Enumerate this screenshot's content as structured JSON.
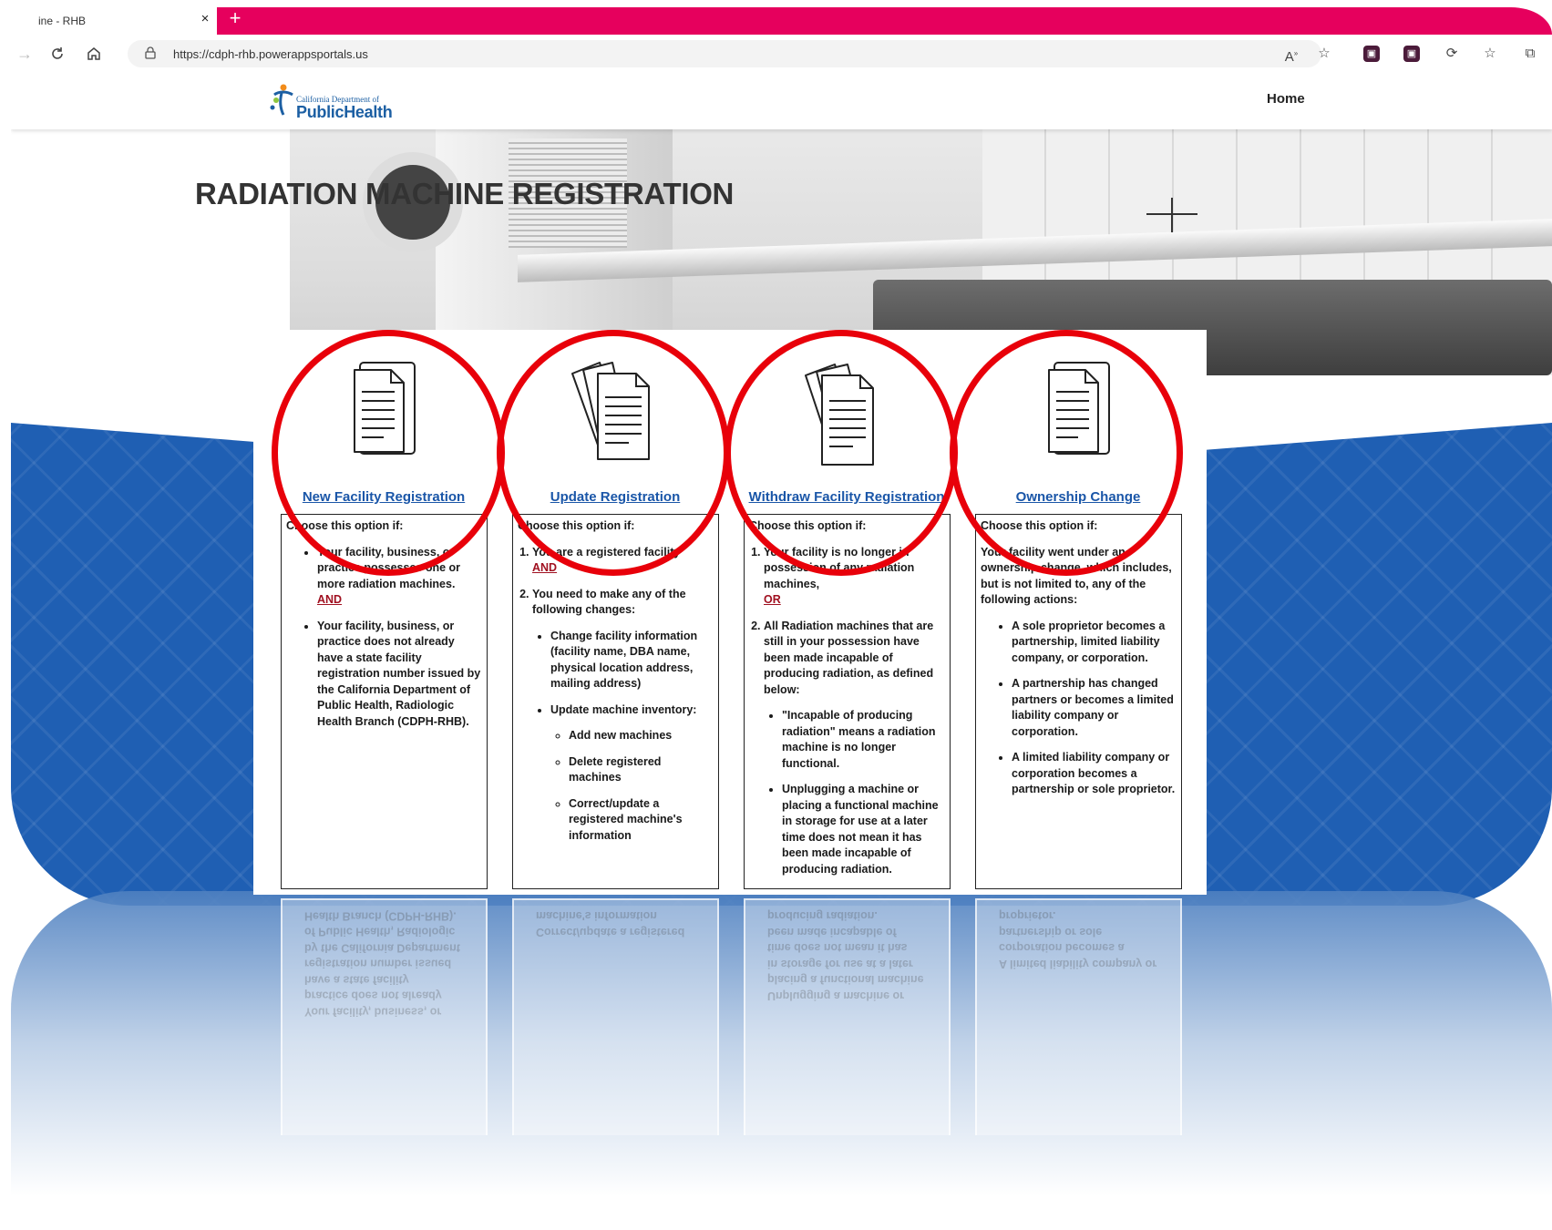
{
  "browser": {
    "tab_title": "ine - RHB",
    "tab_close": "×",
    "new_tab": "+",
    "url": "https://cdph-rhb.powerappsportals.us",
    "nav": {
      "back": "→",
      "refresh": "C",
      "home": "⌂"
    },
    "toolbar_icons": [
      "read-aloud-icon",
      "favorite-add-icon",
      "extension-icon",
      "extension-icon",
      "extensions-icon",
      "favorites-icon",
      "collections-icon"
    ]
  },
  "site": {
    "logo_small": "California Department of",
    "logo_big": "PublicHealth",
    "nav_home": "Home",
    "page_title": "RADIATION MACHINE REGISTRATION"
  },
  "cards": [
    {
      "link": "New Facility Registration",
      "lead": "Choose this option if:",
      "items": [
        "Your facility, business, or practice possesses one or more radiation machines.",
        "AND",
        "Your facility, business, or practice does not already have a state facility registration number issued by the California Department of Public Health, Radiologic Health Branch (CDPH-RHB)."
      ]
    },
    {
      "link": "Update Registration",
      "lead": "Choose this option if:",
      "item1": "You are a registered facility",
      "conj1": "AND",
      "item2": "You need to make any of the following changes:",
      "sub1": "Change facility information (facility name, DBA name, physical location address, mailing address)",
      "sub2": "Update machine inventory:",
      "subsub": [
        "Add new machines",
        "Delete registered machines",
        "Correct/update a registered machine's information"
      ]
    },
    {
      "link": "Withdraw Facility Registration",
      "lead": "Choose this option if:",
      "item1": "Your facility is no longer in possession of any radiation machines,",
      "conj1": "OR",
      "item2": "All Radiation machines that are still in your possession have been made incapable of producing radiation, as defined below:",
      "sub": [
        "\"Incapable of producing radiation\" means a radiation machine is no longer functional.",
        "Unplugging a machine or placing a functional machine in storage for use at a later time does not mean it has been made incapable of producing radiation."
      ]
    },
    {
      "link": "Ownership Change",
      "lead": "Choose this option if:",
      "intro": "Your facility went under an ownership change, which includes, but is not limited to, any of the following actions:",
      "items": [
        "A sole proprietor becomes a partnership, limited liability company, or corporation.",
        "A partnership has changed partners or becomes a limited liability company or corporation.",
        "A limited liability company or corporation becomes a partnership or sole proprietor."
      ]
    }
  ],
  "colors": {
    "browser_accent": "#e6005d",
    "link": "#1a56a8",
    "annotation_circle": "#e8000a",
    "band": "#1f5fb3",
    "conjunction": "#a01020"
  }
}
